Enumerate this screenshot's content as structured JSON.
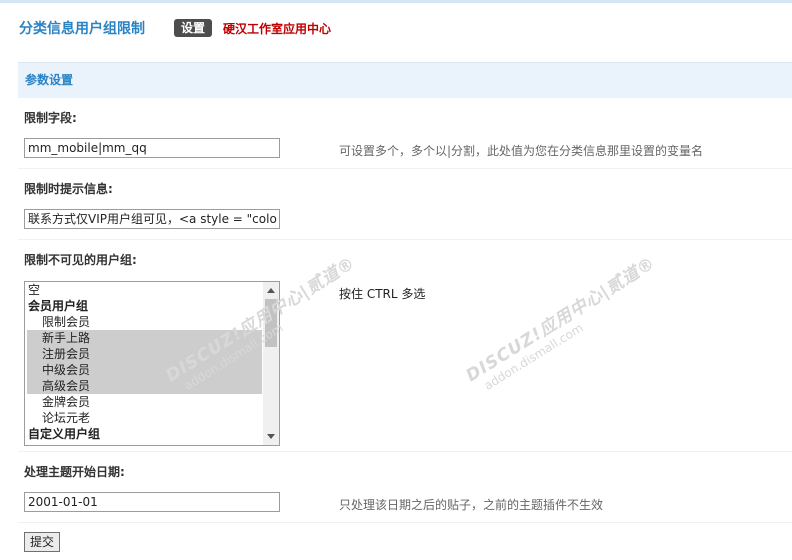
{
  "header": {
    "title": "分类信息用户组限制",
    "badge": "设置",
    "link": "硬汉工作室应用中心"
  },
  "section": {
    "title": "参数设置"
  },
  "fields": {
    "limit_field": {
      "label": "限制字段:",
      "value": "mm_mobile|mm_qq",
      "hint": "可设置多个，多个以|分割，此处值为您在分类信息那里设置的变量名"
    },
    "limit_message": {
      "label": "限制时提示信息:",
      "value": "联系方式仅VIP用户组可见，<a style = \"colo"
    },
    "hidden_groups": {
      "label": "限制不可见的用户组:",
      "hint": "按住 CTRL 多选",
      "options": [
        {
          "text": "空",
          "kind": "plain",
          "selected": false
        },
        {
          "text": "会员用户组",
          "kind": "group",
          "selected": false
        },
        {
          "text": "限制会员",
          "kind": "child",
          "selected": false
        },
        {
          "text": "新手上路",
          "kind": "child",
          "selected": true
        },
        {
          "text": "注册会员",
          "kind": "child",
          "selected": true
        },
        {
          "text": "中级会员",
          "kind": "child",
          "selected": true
        },
        {
          "text": "高级会员",
          "kind": "child",
          "selected": true
        },
        {
          "text": "金牌会员",
          "kind": "child",
          "selected": false
        },
        {
          "text": "论坛元老",
          "kind": "child",
          "selected": false
        },
        {
          "text": "自定义用户组",
          "kind": "group",
          "selected": false
        }
      ]
    },
    "start_date": {
      "label": "处理主题开始日期:",
      "value": "2001-01-01",
      "hint": "只处理该日期之后的贴子，之前的主题插件不生效"
    }
  },
  "submit_label": "提交",
  "watermark": {
    "brand": "DISCUZ!应用中心|贰道®",
    "url": "addon.dismall.com"
  }
}
